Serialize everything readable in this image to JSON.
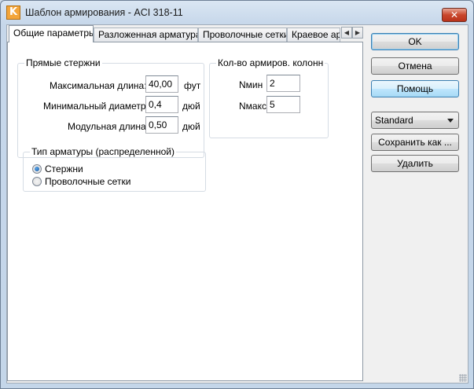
{
  "window": {
    "icon_letter": "K",
    "title": "Шаблон армирования - ACI 318-11",
    "close_glyph": "✕"
  },
  "tabs": [
    {
      "label": "Общие параметры",
      "active": true
    },
    {
      "label": "Разложенная арматура",
      "active": false
    },
    {
      "label": "Проволочные сетки",
      "active": false
    },
    {
      "label": "Краевое арм",
      "active": false
    }
  ],
  "tab_scroll": {
    "left_glyph": "◀",
    "right_glyph": "▶"
  },
  "straight_bars": {
    "title": "Прямые стержни",
    "rows": [
      {
        "label": "Максимальная длина:",
        "value": "40,00",
        "unit": "фут"
      },
      {
        "label": "Минимальный диаметр:",
        "value": "0,4",
        "unit": "дюй"
      },
      {
        "label": "Модульная длина:",
        "value": "0,50",
        "unit": "дюй"
      }
    ]
  },
  "column_reinf": {
    "title": "Кол-во армиров. колонн",
    "rows": [
      {
        "label": "Nмин",
        "value": "2"
      },
      {
        "label": "Nмакс",
        "value": "5"
      }
    ]
  },
  "reinf_type": {
    "title": "Тип арматуры (распределенной)",
    "options": [
      {
        "label": "Стержни",
        "checked": true
      },
      {
        "label": "Проволочные сетки",
        "checked": false
      }
    ]
  },
  "buttons": {
    "ok": "OK",
    "cancel": "Отмена",
    "help": "Помощь",
    "save_as": "Сохранить как ...",
    "delete": "Удалить"
  },
  "template_select": {
    "value": "Standard"
  },
  "colors": {
    "title_bar": "#c6d7ea",
    "close_button": "#c9462c",
    "radio_selected": "#1a5ea8"
  }
}
